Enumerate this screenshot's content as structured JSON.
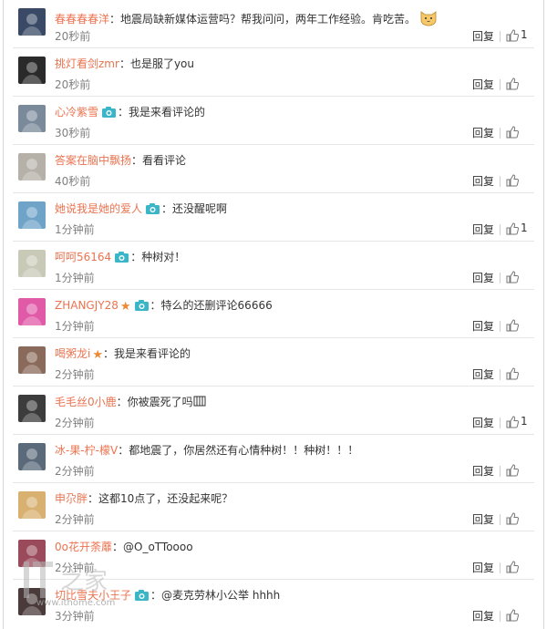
{
  "actions": {
    "reply_label": "回复"
  },
  "comments": [
    {
      "user": "春春春春洋",
      "verified": false,
      "star": false,
      "text": "地震局缺新媒体运营吗？帮我问问，两年工作经验。肯吃苦。",
      "emoji": "cat-face",
      "time": "20秒前",
      "likes": "1",
      "avatar_color": "#3a4a66"
    },
    {
      "user": "挑灯看剑zmr",
      "verified": false,
      "star": false,
      "text": "也是服了you",
      "emoji": "",
      "time": "20秒前",
      "likes": "",
      "avatar_color": "#2a2a2a"
    },
    {
      "user": "心冷紫雪",
      "verified": true,
      "star": false,
      "text": "我是来看评论的",
      "emoji": "",
      "time": "30秒前",
      "likes": "",
      "avatar_color": "#7a8a9a"
    },
    {
      "user": "答案在脑中飘扬",
      "verified": false,
      "star": false,
      "text": "看看评论",
      "emoji": "",
      "time": "40秒前",
      "likes": "",
      "avatar_color": "#b5b0a8"
    },
    {
      "user": "她说我是她的爱人",
      "verified": true,
      "star": false,
      "text": "还没醒呢啊",
      "emoji": "",
      "time": "1分钟前",
      "likes": "1",
      "avatar_color": "#6fa3c8"
    },
    {
      "user": "呵呵56164",
      "verified": true,
      "star": false,
      "text": "种树对！",
      "emoji": "",
      "time": "1分钟前",
      "likes": "",
      "avatar_color": "#c9c9b8"
    },
    {
      "user": "ZHANGJY28",
      "verified": true,
      "star": true,
      "text": "特么的还删评论66666",
      "emoji": "",
      "time": "1分钟前",
      "likes": "",
      "avatar_color": "#e05aa8"
    },
    {
      "user": "喝粥龙i",
      "verified": false,
      "star": true,
      "text": "我是来看评论的",
      "emoji": "",
      "time": "2分钟前",
      "likes": "",
      "avatar_color": "#8a6a5a"
    },
    {
      "user": "毛毛丝0小鹿",
      "verified": false,
      "star": false,
      "text": "你被震死了吗",
      "emoji": "box",
      "time": "2分钟前",
      "likes": "1",
      "avatar_color": "#3c3c3c"
    },
    {
      "user": "冰-果-柠-檬V",
      "verified": false,
      "star": false,
      "text": "都地震了，你居然还有心情种树！！种树！！！",
      "emoji": "",
      "time": "2分钟前",
      "likes": "",
      "avatar_color": "#5a6a7a"
    },
    {
      "user": "申尕胖",
      "verified": false,
      "star": false,
      "text": "这都10点了，还没起来呢？",
      "emoji": "",
      "time": "2分钟前",
      "likes": "",
      "avatar_color": "#d8b070"
    },
    {
      "user": "0o花开荼蘼",
      "verified": false,
      "star": false,
      "text": "@O_oTToooo",
      "emoji": "",
      "time": "2分钟前",
      "likes": "",
      "avatar_color": "#9a4a5a"
    },
    {
      "user": "切比雪夫小王子",
      "verified": true,
      "star": false,
      "text": "@麦克劳林小公举 hhhh",
      "emoji": "",
      "time": "3分钟前",
      "likes": "",
      "avatar_color": "#4a3a3a"
    }
  ],
  "watermark": {
    "logo": "IT之家",
    "url": "www.ithome.com"
  }
}
